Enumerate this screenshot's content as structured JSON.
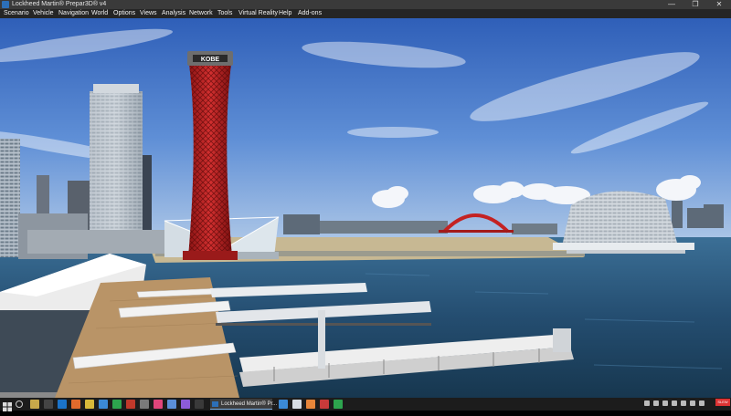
{
  "window": {
    "title": "Lockheed Martin® Prepar3D® v4",
    "controls": [
      "—",
      "❐",
      "✕"
    ]
  },
  "menu": [
    "Scenario",
    "Vehicle",
    "Navigation",
    "World",
    "Options",
    "Views",
    "Analysis",
    "Network",
    "Tools",
    "Virtual Reality",
    "Help",
    "Add-ons"
  ],
  "scene": {
    "tower_sign": "KOBE",
    "status_badge": "SLEW"
  },
  "taskbar": {
    "active_app_label": "Lockheed Martin® Pr...",
    "notification": "SLEW",
    "colors": {
      "background": "#1c1c1c",
      "accent": "#7db2e8"
    }
  }
}
